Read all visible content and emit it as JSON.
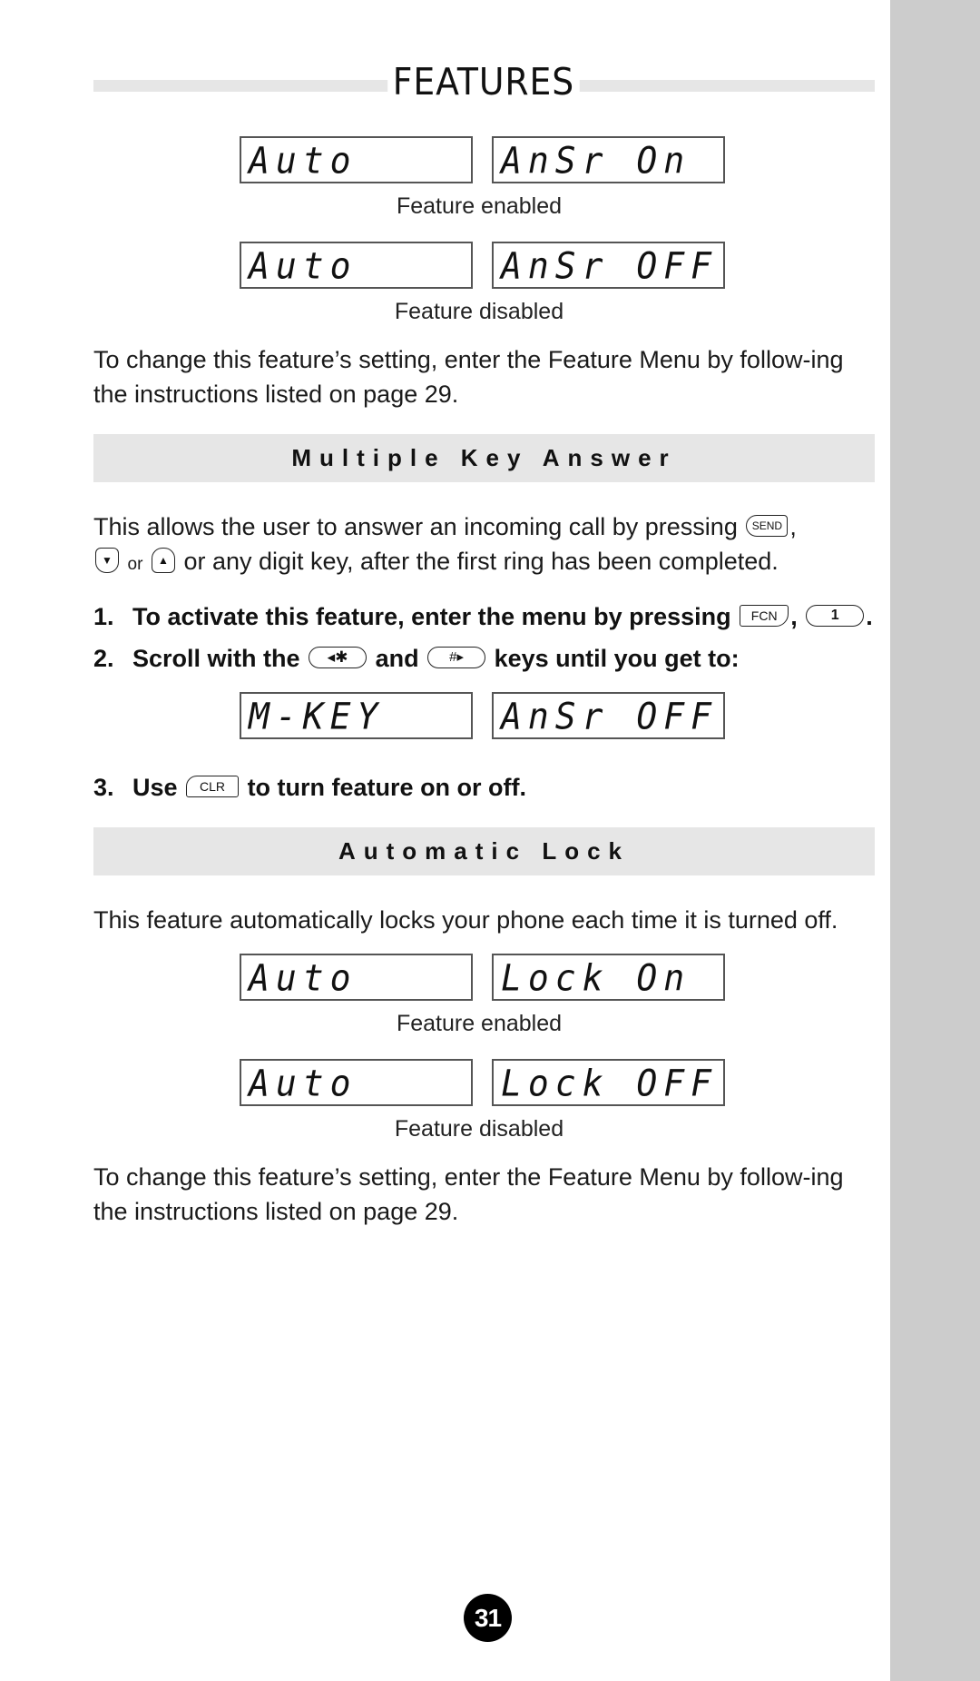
{
  "page": {
    "title": "FEATURES",
    "page_number": "31"
  },
  "auto_answer": {
    "enabled": {
      "left": "Auto",
      "right": "AnSr On",
      "caption": "Feature enabled"
    },
    "disabled": {
      "left": "Auto",
      "right": "AnSr OFF",
      "caption": "Feature disabled"
    },
    "note": "To change this feature’s setting, enter the Feature Menu by follow-ing the instructions listed on page 29."
  },
  "multiple_key_answer": {
    "heading": "Multiple Key Answer",
    "intro_part1": "This allows the user to answer an incoming call by pressing",
    "intro_part2": ",",
    "intro_part3": "or",
    "intro_part4": "or any digit key, after the first ring has been completed.",
    "keys": {
      "send": "SEND",
      "down": "▼",
      "up": "▲",
      "fcn": "FCN",
      "one": "1",
      "star": "◂✱",
      "hash": "#▸",
      "clr": "CLR"
    },
    "steps": [
      {
        "num": "1.",
        "text_before": "To activate this feature, enter the menu by pressing",
        "sep": ",",
        "end": "."
      },
      {
        "num": "2.",
        "text_before": "Scroll with the",
        "mid": "and",
        "text_after": "keys until you get to:"
      },
      {
        "num": "3.",
        "text_before": "Use",
        "text_after": "to turn feature on or off."
      }
    ],
    "display": {
      "left": "M-KEY",
      "right": "AnSr OFF"
    }
  },
  "automatic_lock": {
    "heading": "Automatic Lock",
    "intro": "This feature automatically locks your phone each time it is turned off.",
    "enabled": {
      "left": "Auto",
      "right": "Lock On",
      "caption": "Feature enabled"
    },
    "disabled": {
      "left": "Auto",
      "right": "Lock OFF",
      "caption": "Feature disabled"
    },
    "note": "To change this feature’s setting, enter the Feature Menu by follow-ing the instructions listed on page 29."
  }
}
